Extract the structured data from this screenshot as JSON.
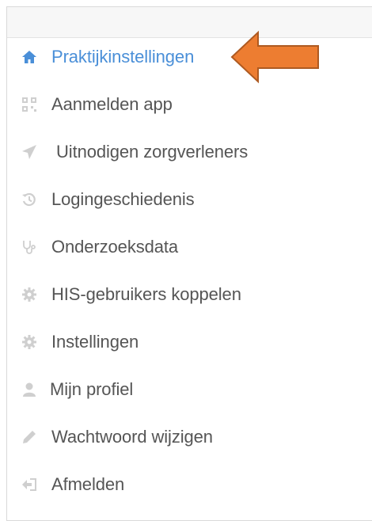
{
  "menu": {
    "items": [
      {
        "label": "Praktijkinstellingen",
        "icon": "home-icon",
        "active": true
      },
      {
        "label": "Aanmelden app",
        "icon": "qr-code-icon",
        "active": false
      },
      {
        "label": "Uitnodigen zorgverleners",
        "icon": "send-icon",
        "active": false
      },
      {
        "label": "Logingeschiedenis",
        "icon": "history-icon",
        "active": false
      },
      {
        "label": "Onderzoeksdata",
        "icon": "stethoscope-icon",
        "active": false
      },
      {
        "label": "HIS-gebruikers koppelen",
        "icon": "gear-icon",
        "active": false
      },
      {
        "label": "Instellingen",
        "icon": "gear-icon",
        "active": false
      },
      {
        "label": "Mijn profiel",
        "icon": "user-icon",
        "active": false
      },
      {
        "label": "Wachtwoord wijzigen",
        "icon": "pencil-icon",
        "active": false
      },
      {
        "label": "Afmelden",
        "icon": "sign-out-icon",
        "active": false
      }
    ]
  },
  "colors": {
    "active": "#4a8fd8",
    "text": "#555555",
    "icon_muted": "#c9c9c9",
    "arrow_fill": "#ed7d31",
    "arrow_stroke": "#ae5a21"
  }
}
